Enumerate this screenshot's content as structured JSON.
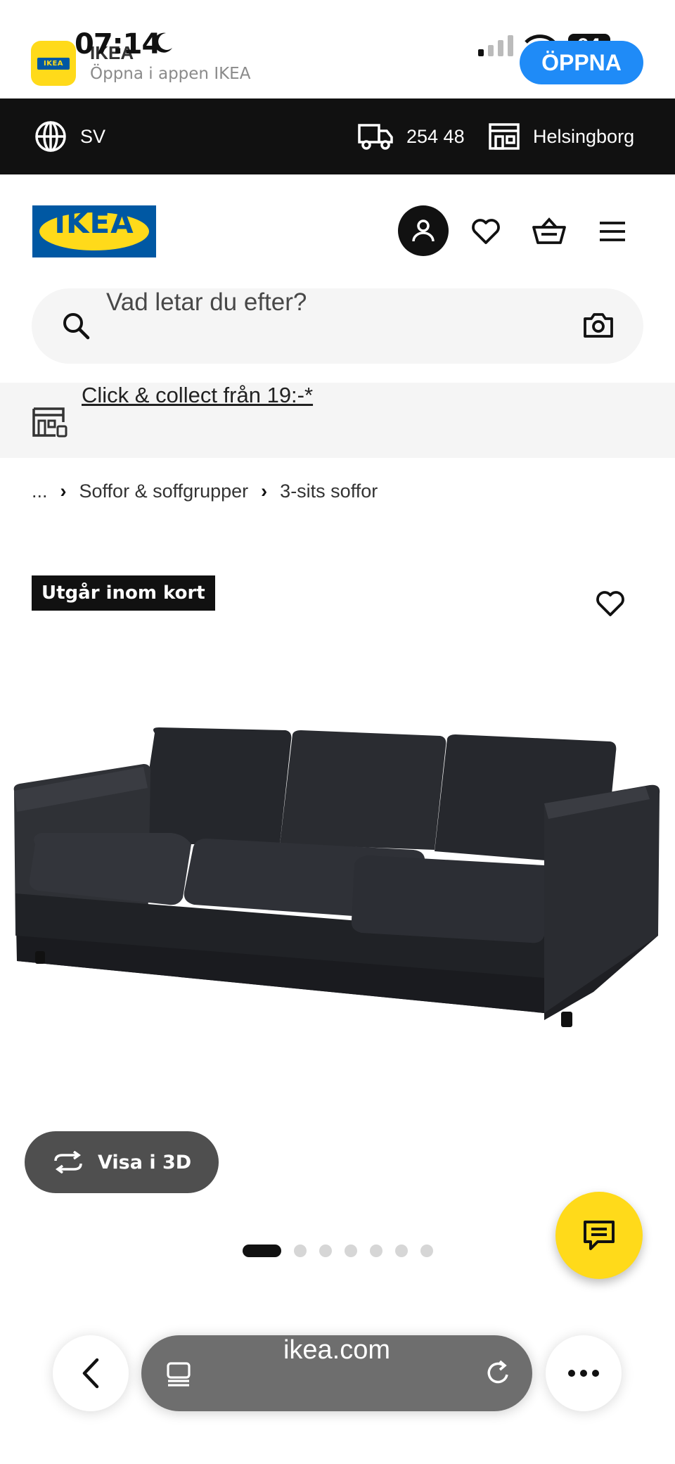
{
  "status_bar": {
    "time": "07:14",
    "battery": "94"
  },
  "app_banner": {
    "app_name": "IKEA",
    "subtitle": "Öppna i appen IKEA",
    "open_label": "ÖPPNA",
    "logo_text": "IKEA"
  },
  "top_bar": {
    "language": "SV",
    "postal_code": "254 48",
    "store": "Helsingborg"
  },
  "header": {
    "logo_text": "IKEA"
  },
  "search": {
    "placeholder": "Vad letar du efter?"
  },
  "click_collect": {
    "text": "Click & collect från 19:-*"
  },
  "breadcrumb": {
    "items": [
      "...",
      "Soffor & soffgrupper",
      "3-sits soffor"
    ]
  },
  "product": {
    "badge": "Utgår inom kort",
    "view_3d_label": "Visa i 3D",
    "carousel": {
      "total": 7,
      "active": 1
    }
  },
  "browser": {
    "url": "ikea.com"
  },
  "colors": {
    "ikea_blue": "#0058A3",
    "ikea_yellow": "#FFDA1A",
    "top_bar": "#111111",
    "open_button": "#1F8BF7"
  }
}
